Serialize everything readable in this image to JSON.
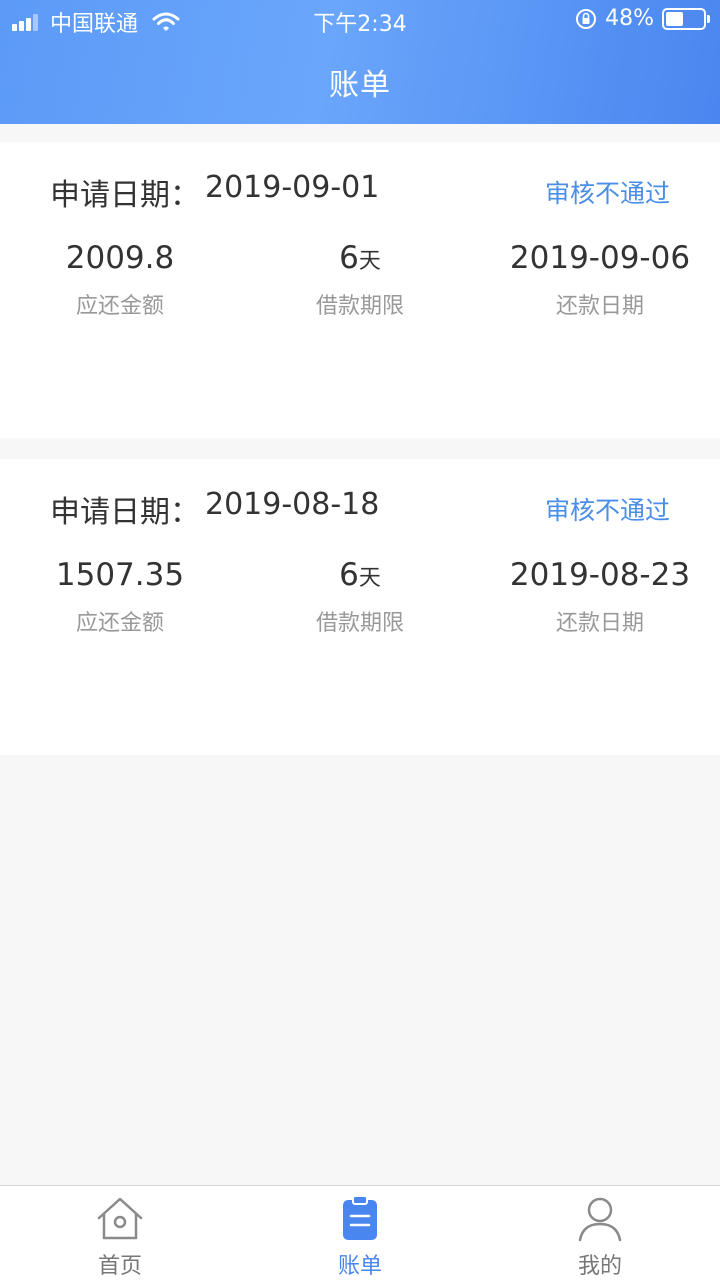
{
  "status_bar": {
    "carrier": "中国联通",
    "time": "下午2:34",
    "battery": "48%"
  },
  "header": {
    "title": "账单"
  },
  "bills": [
    {
      "apply_label": "申请日期：",
      "apply_date": "2019-09-01",
      "status": "审核不通过",
      "amount": "2009.8",
      "amount_label": "应还金额",
      "term": "6",
      "term_unit": "天",
      "term_label": "借款期限",
      "due_date": "2019-09-06",
      "due_label": "还款日期"
    },
    {
      "apply_label": "申请日期：",
      "apply_date": "2019-08-18",
      "status": "审核不通过",
      "amount": "1507.35",
      "amount_label": "应还金额",
      "term": "6",
      "term_unit": "天",
      "term_label": "借款期限",
      "due_date": "2019-08-23",
      "due_label": "还款日期"
    }
  ],
  "tabbar": {
    "items": [
      {
        "label": "首页",
        "icon": "home-icon"
      },
      {
        "label": "账单",
        "icon": "clipboard-icon",
        "active": true
      },
      {
        "label": "我的",
        "icon": "user-icon"
      }
    ]
  },
  "colors": {
    "accent": "#4a86ef",
    "status_text": "#4a8ee8"
  }
}
